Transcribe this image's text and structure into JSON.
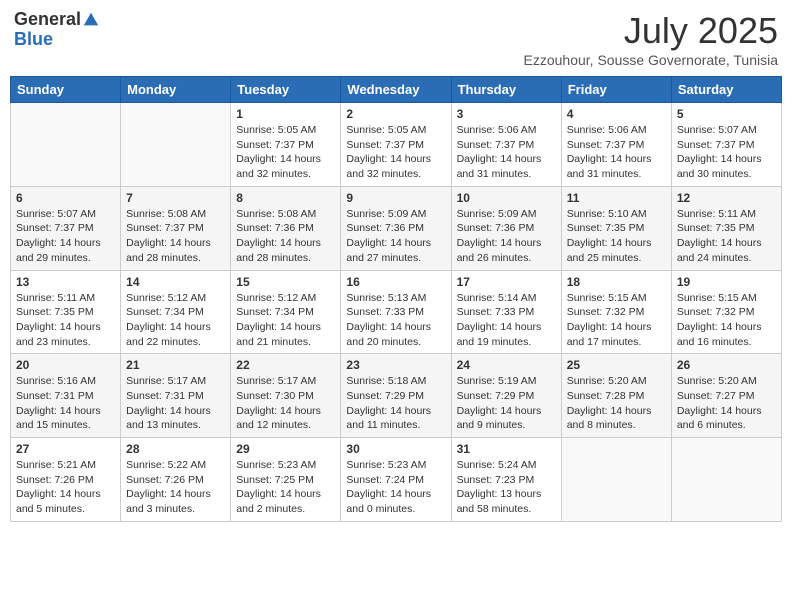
{
  "header": {
    "logo_general": "General",
    "logo_blue": "Blue",
    "month": "July 2025",
    "location": "Ezzouhour, Sousse Governorate, Tunisia"
  },
  "weekdays": [
    "Sunday",
    "Monday",
    "Tuesday",
    "Wednesday",
    "Thursday",
    "Friday",
    "Saturday"
  ],
  "weeks": [
    [
      {
        "day": "",
        "info": ""
      },
      {
        "day": "",
        "info": ""
      },
      {
        "day": "1",
        "info": "Sunrise: 5:05 AM\nSunset: 7:37 PM\nDaylight: 14 hours\nand 32 minutes."
      },
      {
        "day": "2",
        "info": "Sunrise: 5:05 AM\nSunset: 7:37 PM\nDaylight: 14 hours\nand 32 minutes."
      },
      {
        "day": "3",
        "info": "Sunrise: 5:06 AM\nSunset: 7:37 PM\nDaylight: 14 hours\nand 31 minutes."
      },
      {
        "day": "4",
        "info": "Sunrise: 5:06 AM\nSunset: 7:37 PM\nDaylight: 14 hours\nand 31 minutes."
      },
      {
        "day": "5",
        "info": "Sunrise: 5:07 AM\nSunset: 7:37 PM\nDaylight: 14 hours\nand 30 minutes."
      }
    ],
    [
      {
        "day": "6",
        "info": "Sunrise: 5:07 AM\nSunset: 7:37 PM\nDaylight: 14 hours\nand 29 minutes."
      },
      {
        "day": "7",
        "info": "Sunrise: 5:08 AM\nSunset: 7:37 PM\nDaylight: 14 hours\nand 28 minutes."
      },
      {
        "day": "8",
        "info": "Sunrise: 5:08 AM\nSunset: 7:36 PM\nDaylight: 14 hours\nand 28 minutes."
      },
      {
        "day": "9",
        "info": "Sunrise: 5:09 AM\nSunset: 7:36 PM\nDaylight: 14 hours\nand 27 minutes."
      },
      {
        "day": "10",
        "info": "Sunrise: 5:09 AM\nSunset: 7:36 PM\nDaylight: 14 hours\nand 26 minutes."
      },
      {
        "day": "11",
        "info": "Sunrise: 5:10 AM\nSunset: 7:35 PM\nDaylight: 14 hours\nand 25 minutes."
      },
      {
        "day": "12",
        "info": "Sunrise: 5:11 AM\nSunset: 7:35 PM\nDaylight: 14 hours\nand 24 minutes."
      }
    ],
    [
      {
        "day": "13",
        "info": "Sunrise: 5:11 AM\nSunset: 7:35 PM\nDaylight: 14 hours\nand 23 minutes."
      },
      {
        "day": "14",
        "info": "Sunrise: 5:12 AM\nSunset: 7:34 PM\nDaylight: 14 hours\nand 22 minutes."
      },
      {
        "day": "15",
        "info": "Sunrise: 5:12 AM\nSunset: 7:34 PM\nDaylight: 14 hours\nand 21 minutes."
      },
      {
        "day": "16",
        "info": "Sunrise: 5:13 AM\nSunset: 7:33 PM\nDaylight: 14 hours\nand 20 minutes."
      },
      {
        "day": "17",
        "info": "Sunrise: 5:14 AM\nSunset: 7:33 PM\nDaylight: 14 hours\nand 19 minutes."
      },
      {
        "day": "18",
        "info": "Sunrise: 5:15 AM\nSunset: 7:32 PM\nDaylight: 14 hours\nand 17 minutes."
      },
      {
        "day": "19",
        "info": "Sunrise: 5:15 AM\nSunset: 7:32 PM\nDaylight: 14 hours\nand 16 minutes."
      }
    ],
    [
      {
        "day": "20",
        "info": "Sunrise: 5:16 AM\nSunset: 7:31 PM\nDaylight: 14 hours\nand 15 minutes."
      },
      {
        "day": "21",
        "info": "Sunrise: 5:17 AM\nSunset: 7:31 PM\nDaylight: 14 hours\nand 13 minutes."
      },
      {
        "day": "22",
        "info": "Sunrise: 5:17 AM\nSunset: 7:30 PM\nDaylight: 14 hours\nand 12 minutes."
      },
      {
        "day": "23",
        "info": "Sunrise: 5:18 AM\nSunset: 7:29 PM\nDaylight: 14 hours\nand 11 minutes."
      },
      {
        "day": "24",
        "info": "Sunrise: 5:19 AM\nSunset: 7:29 PM\nDaylight: 14 hours\nand 9 minutes."
      },
      {
        "day": "25",
        "info": "Sunrise: 5:20 AM\nSunset: 7:28 PM\nDaylight: 14 hours\nand 8 minutes."
      },
      {
        "day": "26",
        "info": "Sunrise: 5:20 AM\nSunset: 7:27 PM\nDaylight: 14 hours\nand 6 minutes."
      }
    ],
    [
      {
        "day": "27",
        "info": "Sunrise: 5:21 AM\nSunset: 7:26 PM\nDaylight: 14 hours\nand 5 minutes."
      },
      {
        "day": "28",
        "info": "Sunrise: 5:22 AM\nSunset: 7:26 PM\nDaylight: 14 hours\nand 3 minutes."
      },
      {
        "day": "29",
        "info": "Sunrise: 5:23 AM\nSunset: 7:25 PM\nDaylight: 14 hours\nand 2 minutes."
      },
      {
        "day": "30",
        "info": "Sunrise: 5:23 AM\nSunset: 7:24 PM\nDaylight: 14 hours\nand 0 minutes."
      },
      {
        "day": "31",
        "info": "Sunrise: 5:24 AM\nSunset: 7:23 PM\nDaylight: 13 hours\nand 58 minutes."
      },
      {
        "day": "",
        "info": ""
      },
      {
        "day": "",
        "info": ""
      }
    ]
  ]
}
